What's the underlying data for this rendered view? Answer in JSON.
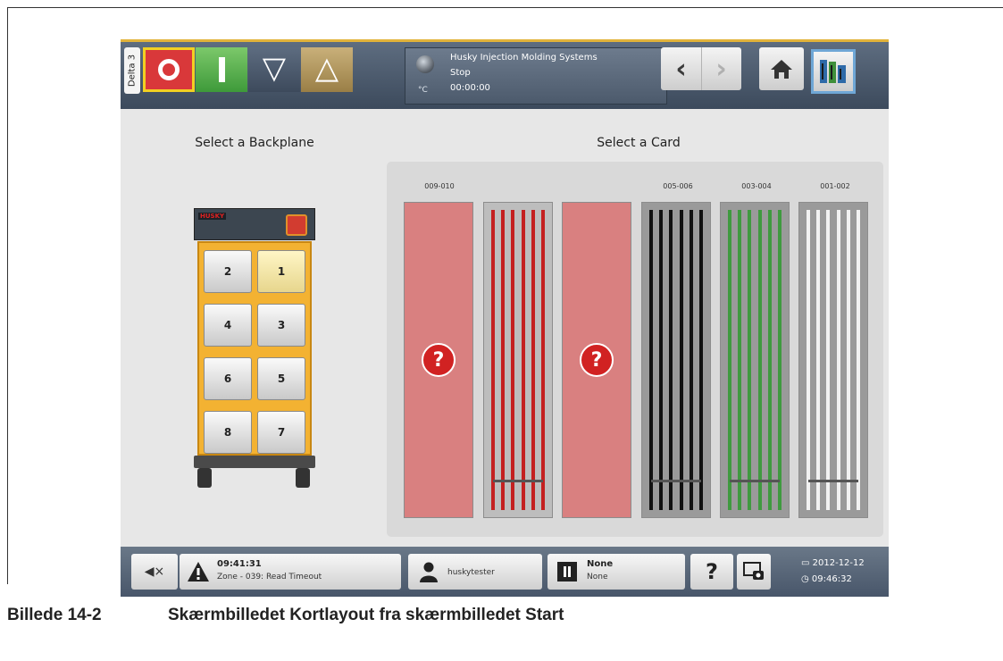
{
  "header": {
    "delta_tab": "Delta 3",
    "status_name": "Husky Injection Molding Systems",
    "status_mode": "Stop",
    "status_time": "00:00:00",
    "unit": "°C"
  },
  "titles": {
    "left": "Select a Backplane",
    "right": "Select a Card"
  },
  "backplane": {
    "logo": "HUSKY",
    "slots": [
      "2",
      "1",
      "4",
      "3",
      "6",
      "5",
      "8",
      "7"
    ],
    "selected": "1"
  },
  "cards": {
    "labels": [
      "009-010",
      "005-006",
      "003-004",
      "001-002"
    ],
    "slots": [
      {
        "state": "empty",
        "icon": "question-icon",
        "symbol": "?"
      },
      {
        "state": "installed",
        "color": "#c42020"
      },
      {
        "state": "empty",
        "icon": "question-icon",
        "symbol": "?"
      },
      {
        "state": "installed",
        "color": "#111111"
      },
      {
        "state": "installed",
        "color": "#3f9a3f"
      },
      {
        "state": "installed",
        "color": "#f2f2f2"
      }
    ]
  },
  "footer": {
    "alarm_time": "09:41:31",
    "alarm_text": "Zone - 039: Read Timeout",
    "user": "huskytester",
    "mold_title": "None",
    "mold_sub": "None",
    "help_symbol": "?",
    "date": "2012-12-12",
    "time": "09:46:32"
  },
  "caption": {
    "number": "Billede 14-2",
    "text": "Skærmbilledet Kortlayout fra skærmbilledet Start"
  },
  "colors": {
    "accent_yellow": "#f3b232",
    "stop_red": "#d9383a",
    "run_green": "#4caf4c"
  }
}
